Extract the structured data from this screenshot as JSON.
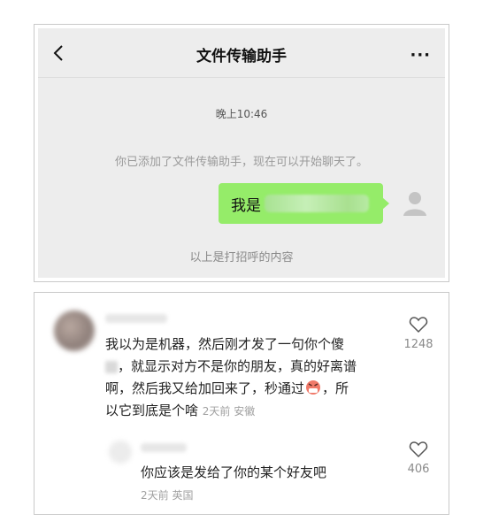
{
  "chat": {
    "title": "文件传输助手",
    "more_label": "···",
    "timestamp": "晚上10:46",
    "system_notice": "你已添加了文件传输助手，现在可以开始聊天了。",
    "bubble_prefix": "我是",
    "greeting_note": "以上是打招呼的内容",
    "bubble_color": "#95ec69",
    "background_color": "#ededed"
  },
  "comments": {
    "main": {
      "text_1": "我以为是机器，然后刚才发了一句你个傻",
      "text_2": "，就显示对方不是你的朋友，真的好离谱",
      "text_3": "啊，然后我又给加回来了，秒通过",
      "text_4": "，所",
      "text_5": "以它到底是个啥",
      "meta": "2天前 安徽",
      "likes": "1248"
    },
    "reply": {
      "text": "你应该是发给了你的某个好友吧",
      "meta": "2天前 英国",
      "likes": "406"
    }
  }
}
